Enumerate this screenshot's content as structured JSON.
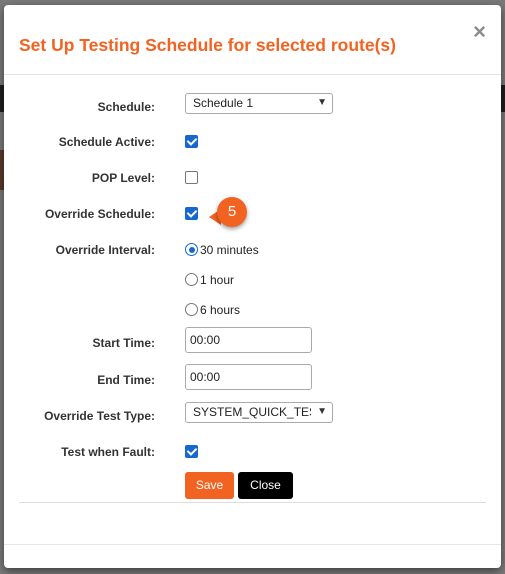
{
  "modal": {
    "title": "Set Up Testing Schedule for selected route(s)",
    "close_glyph": "×"
  },
  "form": {
    "schedule": {
      "label": "Schedule:",
      "value": "Schedule 1"
    },
    "schedule_active": {
      "label": "Schedule Active:",
      "checked": true
    },
    "pop_level": {
      "label": "POP Level:",
      "checked": false
    },
    "override_schedule": {
      "label": "Override Schedule:",
      "checked": true
    },
    "override_interval": {
      "label": "Override Interval:",
      "options": [
        "30 minutes",
        "1 hour",
        "6 hours"
      ],
      "selected": "30 minutes"
    },
    "start_time": {
      "label": "Start Time:",
      "value": "00:00"
    },
    "end_time": {
      "label": "End Time:",
      "value": "00:00"
    },
    "override_test_type": {
      "label": "Override Test Type:",
      "value": "SYSTEM_QUICK_TEST"
    },
    "test_when_fault": {
      "label": "Test when Fault:",
      "checked": true
    }
  },
  "buttons": {
    "save": "Save",
    "close": "Close"
  },
  "callout": {
    "step": "5"
  },
  "colors": {
    "accent": "#f26322",
    "checkbox": "#1767d0",
    "close_button": "#000000"
  }
}
